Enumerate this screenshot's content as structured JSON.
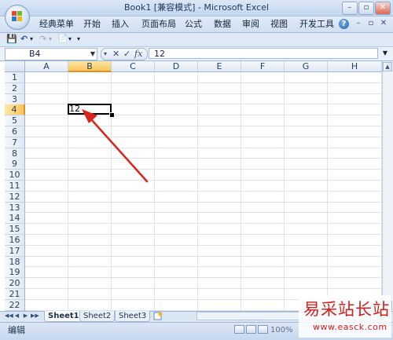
{
  "window": {
    "title": "Book1  [兼容模式] - Microsoft Excel",
    "minimize": "–",
    "restore": "▫",
    "close": "✕"
  },
  "ribbon": {
    "tabs": [
      "经典菜单",
      "开始",
      "插入",
      "页面布局",
      "公式",
      "数据",
      "审阅",
      "视图",
      "开发工具"
    ],
    "help": "?",
    "min_ctl": "–",
    "restore_ctl": "▫",
    "close_ctl": "✕"
  },
  "qat": {
    "save_icon": "💾",
    "undo_icon": "↶",
    "undo_drop": "▾",
    "redo_icon": "↷",
    "redo_drop": "▾",
    "print_icon": "📄",
    "print_drop": "▾",
    "customize": "▾"
  },
  "formula_bar": {
    "name_box": "B4",
    "name_drop": "▼",
    "fx_drop": "▾",
    "cancel": "✕",
    "enter": "✓",
    "fx": "fx",
    "value": "12",
    "expand": "▼"
  },
  "sheet": {
    "columns": [
      "A",
      "B",
      "C",
      "D",
      "E",
      "F",
      "G",
      "H"
    ],
    "rows": [
      "1",
      "2",
      "3",
      "4",
      "5",
      "6",
      "7",
      "8",
      "9",
      "10",
      "11",
      "12",
      "13",
      "14",
      "15",
      "16",
      "17",
      "18",
      "19",
      "20",
      "21",
      "22"
    ],
    "selected_column": "B",
    "selected_row": "4",
    "active_cell_value": "12"
  },
  "scrollbar": {
    "up": "▲",
    "down": "▼"
  },
  "sheet_tabs": {
    "nav": [
      "◀◀",
      "◀",
      "▶",
      "▶▶"
    ],
    "tabs": [
      "Sheet1",
      "Sheet2",
      "Sheet3"
    ],
    "active": "Sheet1"
  },
  "status_bar": {
    "mode": "编辑",
    "zoom": "100%"
  },
  "watermark": {
    "title": "易采站长站",
    "url": "www.easck.com"
  },
  "colors": {
    "arrow": "#d9241c",
    "selected_header": "#f9c55a",
    "watermark": "#d0201e"
  }
}
